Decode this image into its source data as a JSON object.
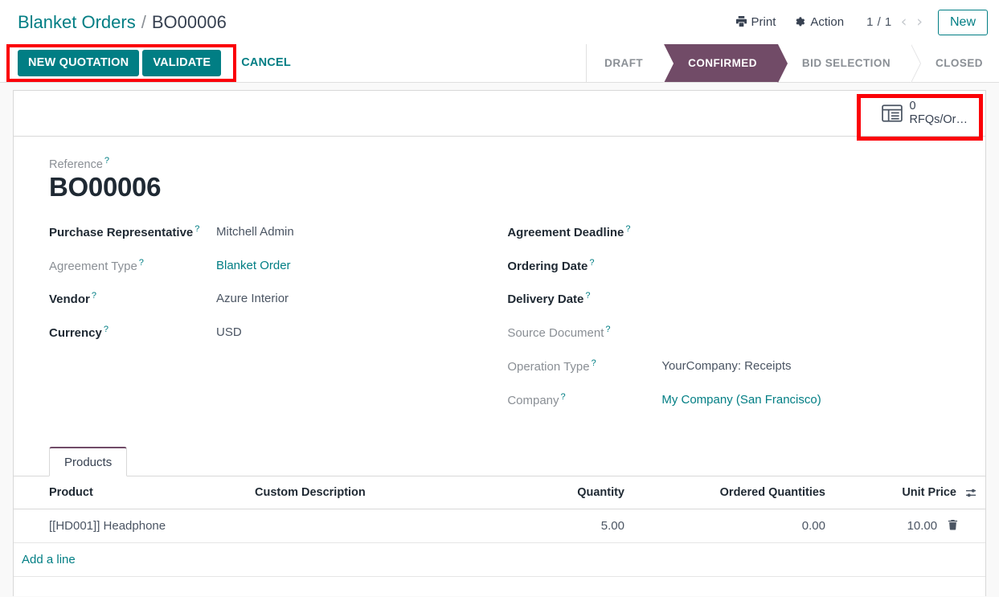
{
  "breadcrumb": {
    "parent": "Blanket Orders",
    "separator": "/",
    "current": "BO00006"
  },
  "control_panel": {
    "print_label": "Print",
    "print_icon": "printer-icon",
    "action_label": "Action",
    "action_icon": "gear-icon",
    "pager": "1 / 1",
    "prev_arrow": "‹",
    "next_arrow": "›",
    "new_label": "New"
  },
  "actions": {
    "new_quotation": "NEW QUOTATION",
    "validate": "VALIDATE",
    "cancel": "CANCEL"
  },
  "statusbar": {
    "stages": [
      {
        "label": "DRAFT",
        "active": false
      },
      {
        "label": "CONFIRMED",
        "active": true
      },
      {
        "label": "BID SELECTION",
        "active": false
      },
      {
        "label": "CLOSED",
        "active": false
      }
    ],
    "active_color": "#714b67"
  },
  "button_box": {
    "rfq": {
      "icon": "list-alt-icon",
      "value": "0",
      "label": "RFQs/Or…"
    }
  },
  "record": {
    "reference_label": "Reference",
    "reference_value": "BO00006"
  },
  "fields_left": [
    {
      "label": "Purchase Representative",
      "required": true,
      "value": "Mitchell Admin",
      "is_link": false,
      "tooltip": "?"
    },
    {
      "label": "Agreement Type",
      "required": false,
      "value": "Blanket Order",
      "is_link": true,
      "tooltip": "?"
    },
    {
      "label": "Vendor",
      "required": true,
      "value": "Azure Interior",
      "is_link": false,
      "tooltip": "?"
    },
    {
      "label": "Currency",
      "required": true,
      "value": "USD",
      "is_link": false,
      "tooltip": "?"
    }
  ],
  "fields_right": [
    {
      "label": "Agreement Deadline",
      "required": true,
      "value": "",
      "is_link": false,
      "tooltip": "?"
    },
    {
      "label": "Ordering Date",
      "required": true,
      "value": "",
      "is_link": false,
      "tooltip": "?"
    },
    {
      "label": "Delivery Date",
      "required": true,
      "value": "",
      "is_link": false,
      "tooltip": "?"
    },
    {
      "label": "Source Document",
      "required": false,
      "value": "",
      "is_link": false,
      "tooltip": "?"
    },
    {
      "label": "Operation Type",
      "required": false,
      "value": "YourCompany: Receipts",
      "is_link": false,
      "tooltip": "?"
    },
    {
      "label": "Company",
      "required": false,
      "value": "My Company (San Francisco)",
      "is_link": true,
      "tooltip": "?"
    }
  ],
  "notebook": {
    "tabs": [
      {
        "label": "Products",
        "active": true
      }
    ]
  },
  "lines_table": {
    "columns": [
      "Product",
      "Custom Description",
      "Quantity",
      "Ordered Quantities",
      "Unit Price"
    ],
    "optional_columns_icon": "sliders-icon",
    "rows": [
      {
        "product": "[[HD001]] Headphone",
        "description": "",
        "quantity": "5.00",
        "ordered_quantities": "0.00",
        "unit_price": "10.00",
        "delete_icon": "trash-icon"
      }
    ],
    "add_line_label": "Add a line"
  },
  "theme": {
    "primary": "#017e84",
    "stage_active": "#714b67",
    "annotation": "#fb0007",
    "text_dark": "#1f2933",
    "text_muted": "#8a8f95"
  }
}
